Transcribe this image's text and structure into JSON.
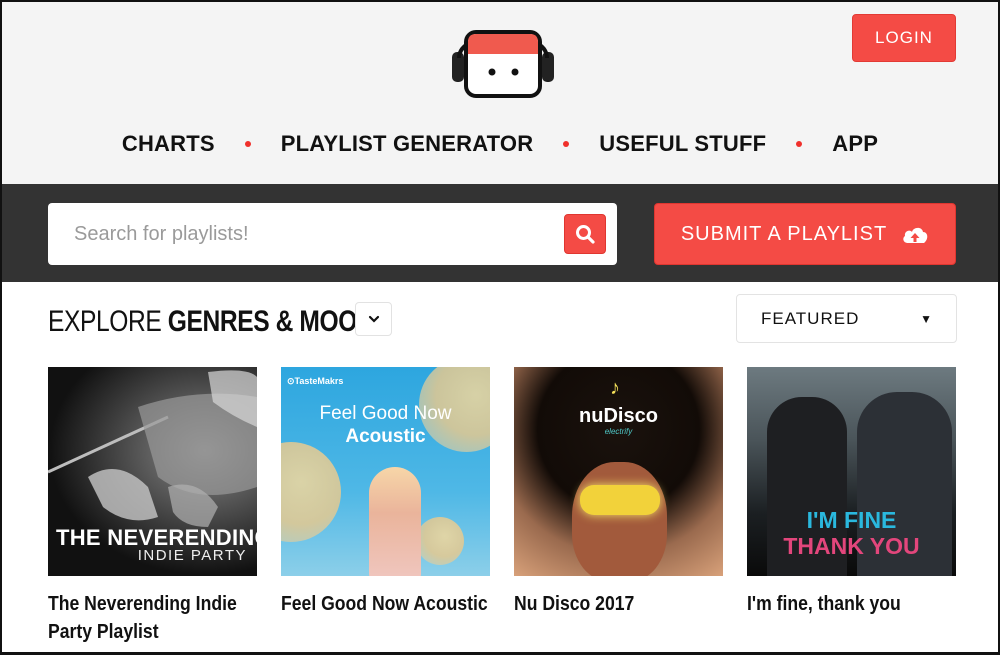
{
  "header": {
    "logo_alt": "playlist-site-logo",
    "login_label": "LOGIN",
    "nav": [
      {
        "label": "CHARTS"
      },
      {
        "label": "PLAYLIST GENERATOR"
      },
      {
        "label": "USEFUL STUFF"
      },
      {
        "label": "APP"
      }
    ]
  },
  "search": {
    "placeholder": "Search for playlists!",
    "value": "",
    "submit_label": "SUBMIT A PLAYLIST"
  },
  "explore": {
    "title_light": "EXPLORE",
    "title_bold": "GENRES & MOODS",
    "sort_selected": "FEATURED",
    "sort_caret": "▼"
  },
  "colors": {
    "accent": "#f44b45",
    "band": "#333333",
    "header_bg": "#f4f4f4"
  },
  "playlists": [
    {
      "title": "The Neverending Indie Party Playlist",
      "cover_line1": "THE NEVERENDING",
      "cover_line2": "INDIE PARTY"
    },
    {
      "title": "Feel Good Now Acoustic",
      "cover_brand": "⊙TasteMakrs",
      "cover_line1": "Feel Good Now",
      "cover_line2": "Acoustic"
    },
    {
      "title": "Nu Disco 2017",
      "cover_line1": "nuDisco",
      "cover_line2": "electrify"
    },
    {
      "title": "I'm fine, thank you",
      "cover_line1": "I'M FINE",
      "cover_line2": "THANK YOU"
    }
  ]
}
